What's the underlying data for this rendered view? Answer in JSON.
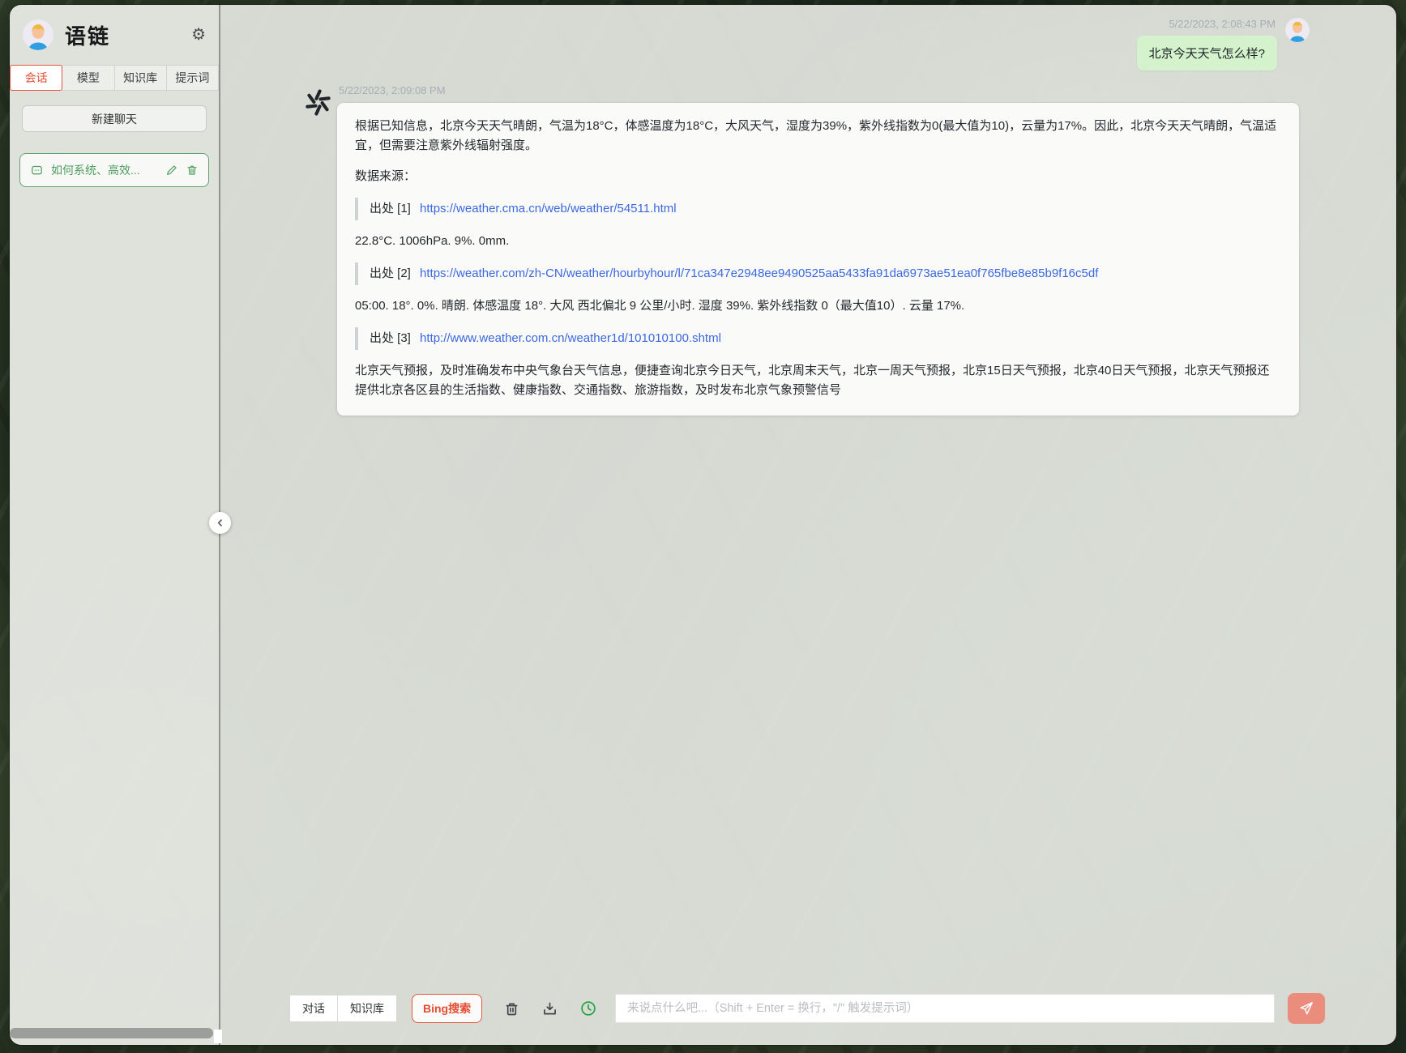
{
  "app": {
    "title": "语链"
  },
  "sidebar": {
    "tabs": [
      {
        "label": "会话",
        "active": true
      },
      {
        "label": "模型",
        "active": false
      },
      {
        "label": "知识库",
        "active": false
      },
      {
        "label": "提示词",
        "active": false
      }
    ],
    "new_chat_label": "新建聊天",
    "conversations": [
      {
        "title": "如何系统、高效..."
      }
    ]
  },
  "chat": {
    "user_message": {
      "timestamp": "5/22/2023, 2:08:43 PM",
      "text": "北京今天天气怎么样?"
    },
    "assistant_message": {
      "timestamp": "5/22/2023, 2:09:08 PM",
      "intro": "根据已知信息，北京今天天气晴朗，气温为18°C，体感温度为18°C，大风天气，湿度为39%，紫外线指数为0(最大值为10)，云量为17%。因此，北京今天天气晴朗，气温适宜，但需要注意紫外线辐射强度。",
      "sources_label": "数据来源：",
      "citations": [
        {
          "ref": "出处 [1]",
          "url": "https://weather.cma.cn/web/weather/54511.html",
          "note": "22.8°C. 1006hPa. 9%. 0mm."
        },
        {
          "ref": "出处 [2]",
          "url": "https://weather.com/zh-CN/weather/hourbyhour/l/71ca347e2948ee9490525aa5433fa91da6973ae51ea0f765fbe8e85b9f16c5df",
          "note": "05:00. 18°. 0%. 晴朗. 体感温度 18°. 大风 西北偏北 9 公里/小时. 湿度 39%. 紫外线指数 0（最大值10）. 云量 17%."
        },
        {
          "ref": "出处 [3]",
          "url": "http://www.weather.com.cn/weather1d/101010100.shtml",
          "note": "北京天气预报，及时准确发布中央气象台天气信息，便捷查询北京今日天气，北京周末天气，北京一周天气预报，北京15日天气预报，北京40日天气预报，北京天气预报还提供北京各区县的生活指数、健康指数、交通指数、旅游指数，及时发布北京气象预警信号"
        }
      ]
    }
  },
  "composer": {
    "modes": [
      {
        "label": "对话",
        "active": false
      },
      {
        "label": "知识库",
        "active": false
      },
      {
        "label": "Bing搜索",
        "active": true
      }
    ],
    "placeholder": "来说点什么吧...（Shift + Enter = 换行，\"/\" 触发提示词）"
  },
  "colors": {
    "accent_red": "#e44c31",
    "accent_green": "#4f9c60",
    "link_blue": "#3b68e0",
    "user_bubble_green": "#d4f3cd",
    "send_button_salmon": "#eb8d7d",
    "history_icon_green": "#27a348"
  }
}
